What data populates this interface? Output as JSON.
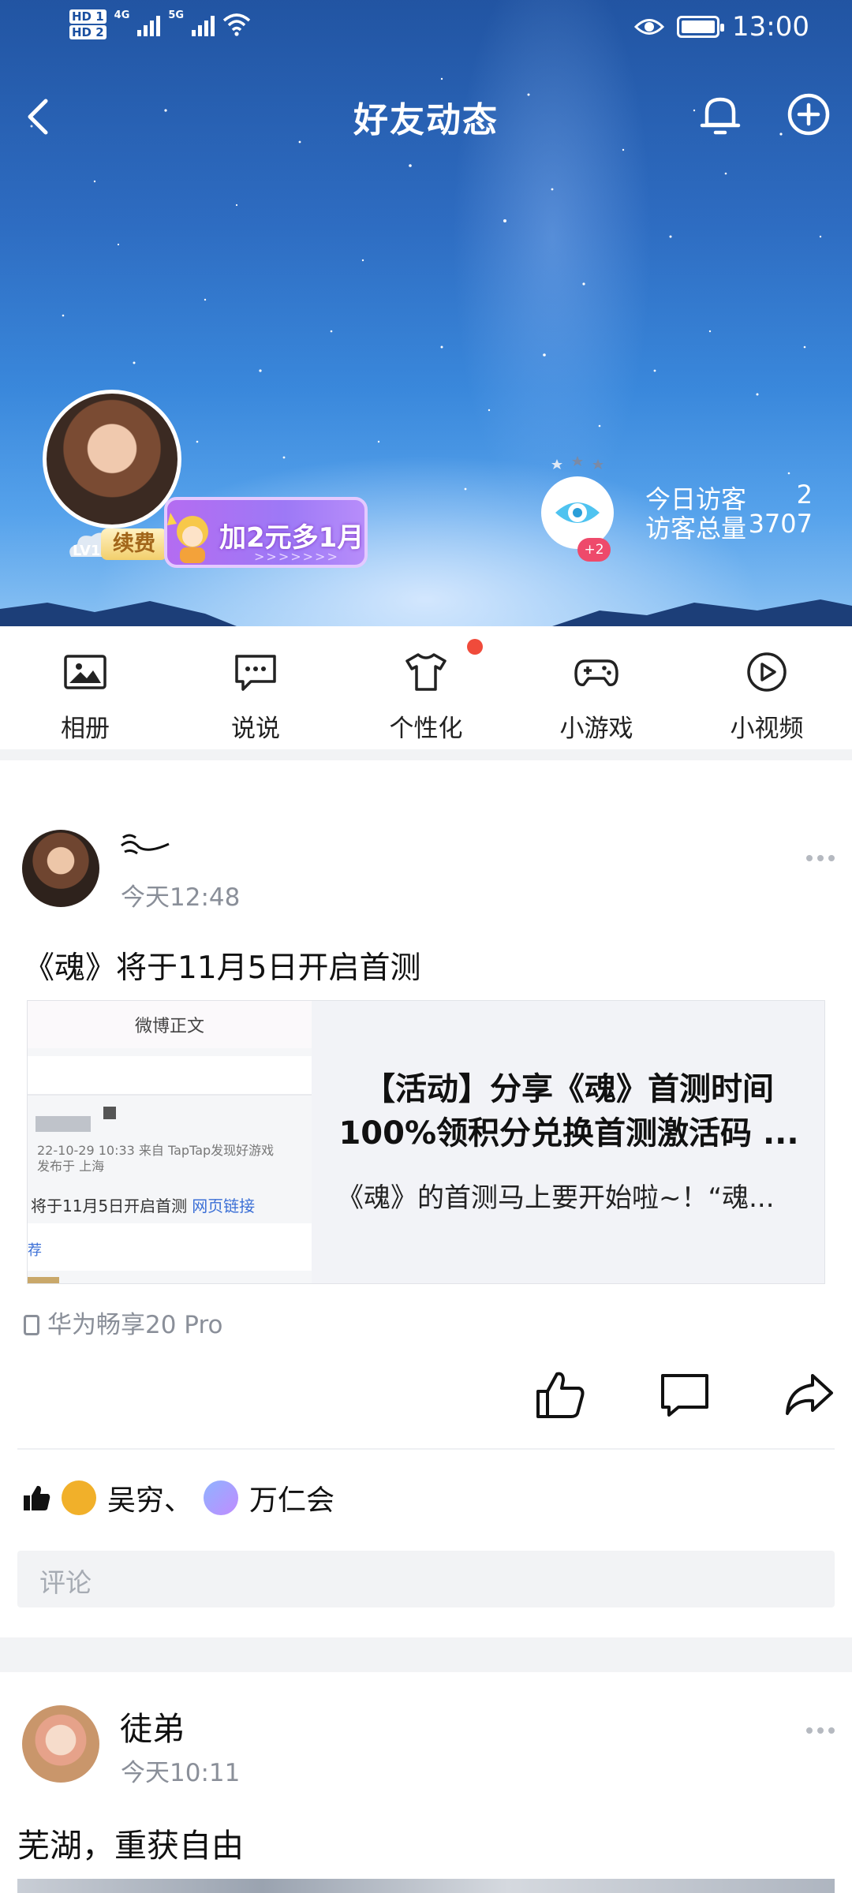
{
  "status_bar": {
    "hd1": "HD 1",
    "hd2": "HD 2",
    "net1": "4G",
    "net2": "5G",
    "time": "13:00"
  },
  "nav": {
    "title": "好友动态",
    "back_icon": "chevron-left-icon",
    "bell_icon": "bell-icon",
    "add_icon": "plus-circle-icon"
  },
  "profile": {
    "level": "LV1",
    "renew": "续费",
    "promo": "加2元多1月",
    "visitor_plus": "+2",
    "today_visitors_label": "今日访客",
    "today_visitors": "2",
    "total_visitors_label": "访客总量",
    "total_visitors": "3707"
  },
  "quick_entries": [
    {
      "label": "相册",
      "icon": "photo-album-icon"
    },
    {
      "label": "说说",
      "icon": "message-bubble-icon"
    },
    {
      "label": "个性化",
      "icon": "tshirt-icon"
    },
    {
      "label": "小游戏",
      "icon": "gamepad-icon"
    },
    {
      "label": "小视频",
      "icon": "play-circle-icon"
    }
  ],
  "posts": [
    {
      "time": "今天12:48",
      "text": "《魂》将于11月5日开启首测",
      "card": {
        "thumb_header": "微博正文",
        "thumb_meta1": "22-10-29 10:33  来自 TapTap发现好游戏",
        "thumb_meta2": "发布于 上海",
        "thumb_body": "将于11月5日开启首测",
        "thumb_link": "网页链接",
        "thumb_foot": "荐",
        "title_line1": "【活动】分享《魂》首测时间",
        "title_line2": "100%领积分兑换首测激活码 ...",
        "desc": "《魂》的首测马上要开始啦~！“魂..."
      },
      "device": "华为畅享20 Pro",
      "likes": {
        "name1": "吴穷、",
        "name2": "万仁会"
      },
      "comment_placeholder": "评论"
    },
    {
      "name": "徒弟",
      "time": "今天10:11",
      "text": "芜湖，重获自由"
    }
  ],
  "colors": {
    "accent_red": "#f04b3b",
    "link_blue": "#3b6fd6",
    "promo_purple": "#b46cf1"
  }
}
